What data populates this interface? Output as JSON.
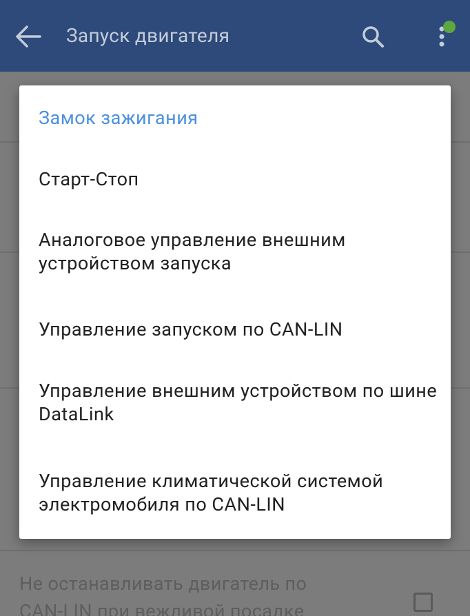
{
  "appbar": {
    "title": "Запуск двигателя",
    "back_icon": "arrow-left-icon",
    "search_icon": "search-icon",
    "more_icon": "more-vertical-icon",
    "badge_color": "#5ea640",
    "background_color": "#2d4a7a"
  },
  "dialog": {
    "options": [
      {
        "label": "Замок зажигания",
        "selected": true
      },
      {
        "label": "Старт-Стоп",
        "selected": false
      },
      {
        "label": "Аналоговое управление внешним устройством запуска",
        "selected": false
      },
      {
        "label": "Управление запуском по CAN-LIN",
        "selected": false
      },
      {
        "label": "Управление внешним устройством по шине DataLink",
        "selected": false
      },
      {
        "label": "Управление климатической системой электромобиля по CAN-LIN",
        "selected": false
      }
    ],
    "selected_color": "#4a90e2"
  },
  "background": {
    "setting_label_line1": "Не останавливать двигатель по",
    "setting_label_line2": "CAN-LIN при вежливой посадке"
  }
}
